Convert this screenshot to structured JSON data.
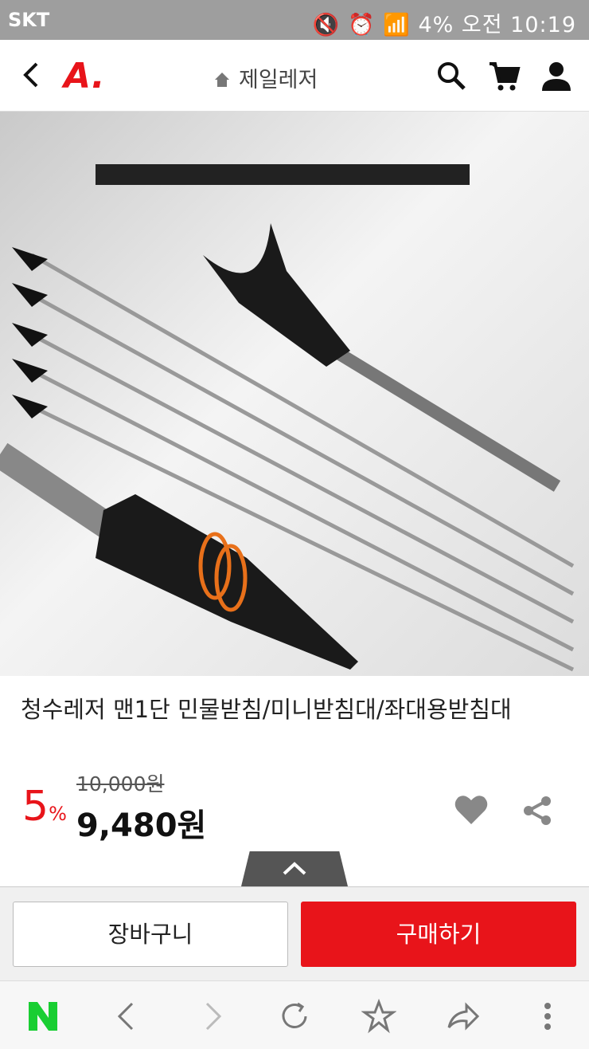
{
  "status": {
    "carrier": "SKT",
    "battery": "4%",
    "time": "오전 10:19"
  },
  "header": {
    "logo": "A.",
    "breadcrumb": "제일레저"
  },
  "product": {
    "title": "청수레저 맨1단 민물받침/미니받침대/좌대용받침대",
    "original_price": "10,000원",
    "discount": "5",
    "discount_unit": "%",
    "price": "9,480원"
  },
  "actions": {
    "cart_label": "장바구니",
    "buy_label": "구매하기"
  },
  "colors": {
    "brand": "#e8141a"
  }
}
